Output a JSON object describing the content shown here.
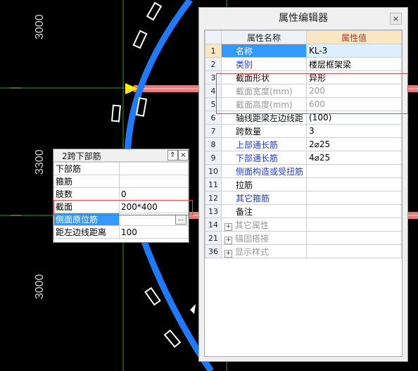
{
  "canvas": {
    "dimensions": [
      "3000",
      "3300",
      "3000"
    ]
  },
  "small_editor": {
    "title": "2跨下部筋",
    "rows": [
      {
        "key": "下部筋",
        "value": ""
      },
      {
        "key": "箍筋",
        "value": ""
      },
      {
        "key": "肢数",
        "value": "0"
      },
      {
        "key": "截面",
        "value": "200*400"
      },
      {
        "key": "侧面原位筋",
        "value": ""
      },
      {
        "key": "距左边线距离",
        "value": "100"
      }
    ],
    "more_label": "..."
  },
  "property_editor": {
    "title": "属性编辑器",
    "close_label": "×",
    "col_name": "属性名称",
    "col_value": "属性值",
    "rows": [
      {
        "num": "1",
        "name": "名称",
        "value": "KL-3",
        "style": "blue"
      },
      {
        "num": "2",
        "name": "类别",
        "value": "楼层框架梁",
        "style": "blue"
      },
      {
        "num": "3",
        "name": "截面形状",
        "value": "异形",
        "style": "black"
      },
      {
        "num": "4",
        "name": "截面宽度(mm)",
        "value": "200",
        "style": "gray"
      },
      {
        "num": "5",
        "name": "截面高度(mm)",
        "value": "600",
        "style": "gray"
      },
      {
        "num": "6",
        "name": "轴线距梁左边线距",
        "value": "(100)",
        "style": "black"
      },
      {
        "num": "7",
        "name": "跨数量",
        "value": "3",
        "style": "black"
      },
      {
        "num": "8",
        "name": "上部通长筋",
        "value": "2⌀25",
        "style": "blue"
      },
      {
        "num": "9",
        "name": "下部通长筋",
        "value": "4⌀25",
        "style": "blue"
      },
      {
        "num": "10",
        "name": "侧面构造或受扭筋",
        "value": "",
        "style": "blue"
      },
      {
        "num": "11",
        "name": "拉筋",
        "value": "",
        "style": "black"
      },
      {
        "num": "12",
        "name": "其它箍筋",
        "value": "",
        "style": "blue"
      },
      {
        "num": "13",
        "name": "备注",
        "value": "",
        "style": "black"
      }
    ],
    "groups": [
      {
        "num": "14",
        "name": "其它属性"
      },
      {
        "num": "21",
        "name": "锚固搭接"
      },
      {
        "num": "36",
        "name": "显示样式"
      }
    ]
  },
  "colors": {
    "arc": "#1e7bff",
    "beam": "#e87a7a",
    "grid": "#1f9f1f",
    "highlight_box": "#e0464e"
  }
}
